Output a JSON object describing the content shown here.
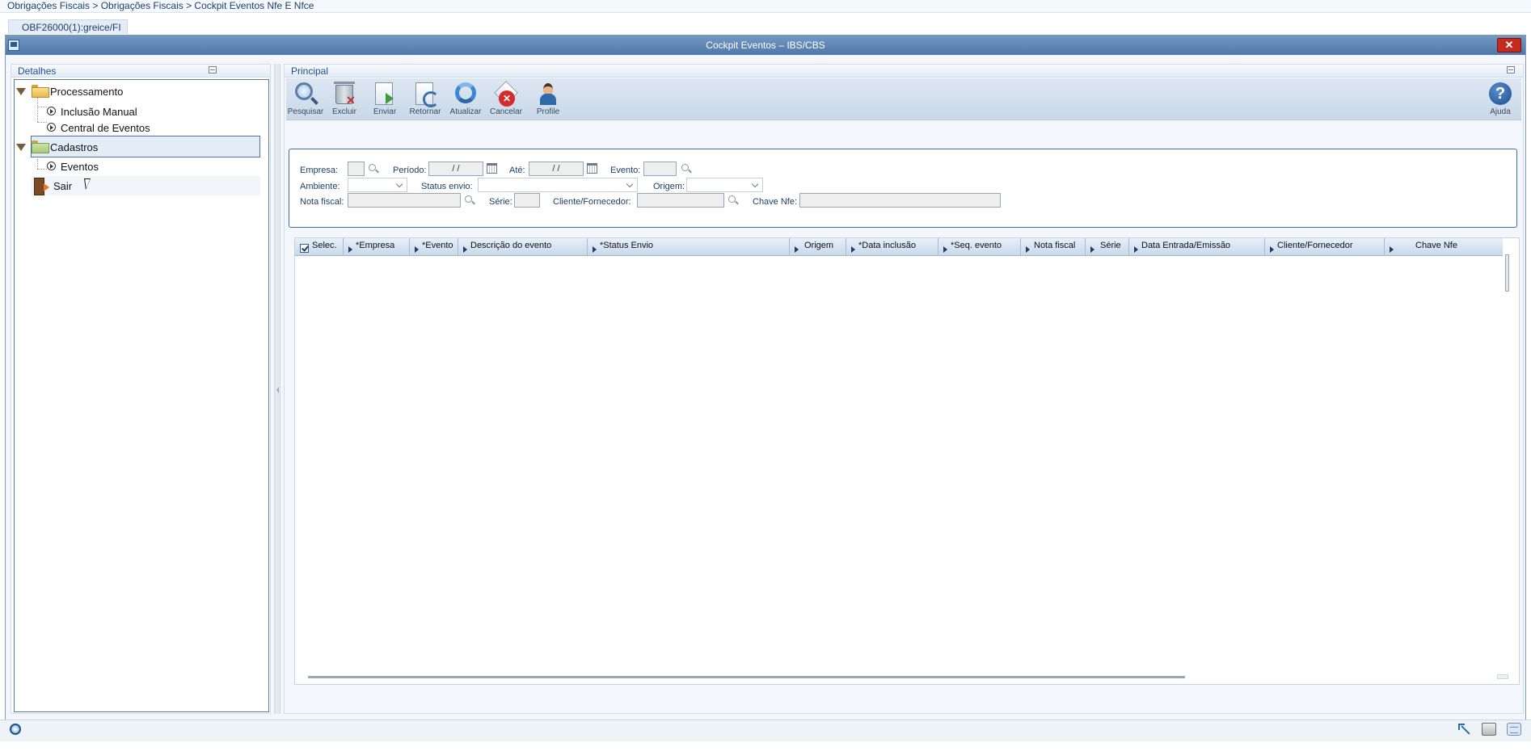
{
  "breadcrumb": "Obrigações Fiscais > Obrigações Fiscais > Cockpit Eventos Nfe E Nfce",
  "program_tab": "OBF26000(1):greice/FI",
  "window": {
    "title": "Cockpit Eventos – IBS/CBS",
    "close": "✕"
  },
  "left_panel": {
    "title": "Detalhes",
    "tree": {
      "processamento": "Processamento",
      "inclusao_manual": "Inclusão Manual",
      "central_eventos": "Central de Eventos",
      "cadastros": "Cadastros",
      "eventos": "Eventos",
      "sair": "Sair"
    }
  },
  "right_panel": {
    "title": "Principal",
    "toolbar": {
      "pesquisar": "Pesquisar",
      "excluir": "Excluir",
      "enviar": "Enviar",
      "retornar": "Retornar",
      "atualizar": "Atualizar",
      "cancelar": "Cancelar",
      "profile": "Profile",
      "ajuda": "Ajuda",
      "help_glyph": "?"
    },
    "filters": {
      "empresa": "Empresa:",
      "periodo": "Período:",
      "periodo_value": "/ /",
      "ate": "Até:",
      "ate_value": "/ /",
      "evento": "Evento:",
      "ambiente": "Ambiente:",
      "status_envio": "Status envio:",
      "origem": "Origem:",
      "nota_fiscal": "Nota fiscal:",
      "serie": "Série:",
      "cliente_fornecedor": "Cliente/Fornecedor:",
      "chave_nfe": "Chave Nfe:"
    },
    "grid": {
      "columns": [
        "Selec.",
        "*Empresa",
        "*Evento",
        "Descrição do evento",
        "*Status Envio",
        "Origem",
        "*Data inclusão",
        "*Seq. evento",
        "Nota fiscal",
        "Série",
        "Data Entrada/Emissão",
        "Cliente/Fornecedor",
        "Chave Nfe"
      ],
      "rows": []
    }
  },
  "icons": {
    "toolbar": [
      "search-icon",
      "trash-icon",
      "send-document-icon",
      "return-document-icon",
      "refresh-icon",
      "cancel-icon",
      "profile-icon",
      "help-icon"
    ],
    "status": [
      "globe-icon",
      "expand-icon",
      "print-icon",
      "chat-icon"
    ]
  }
}
